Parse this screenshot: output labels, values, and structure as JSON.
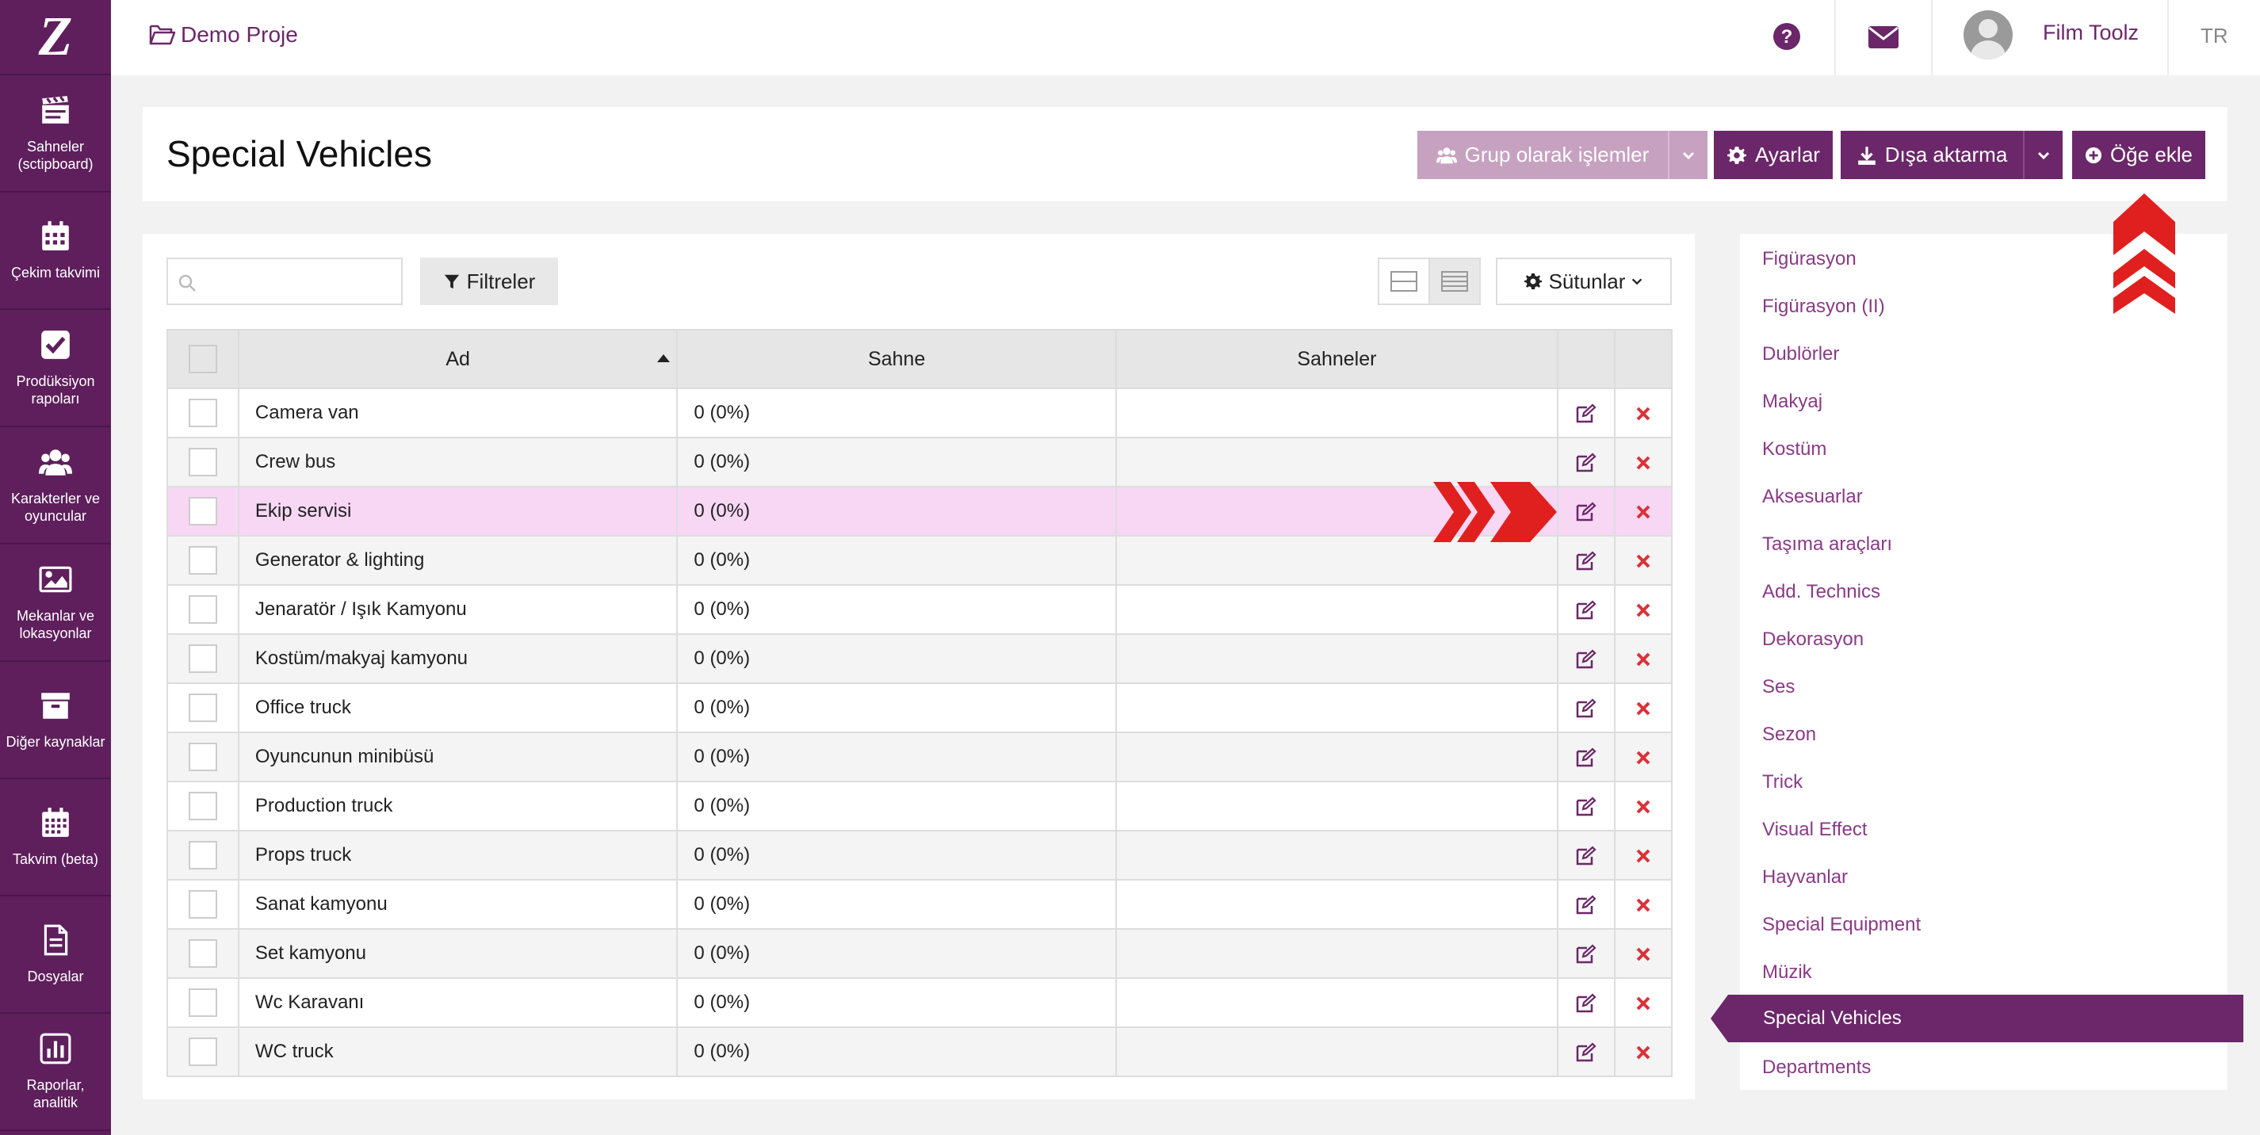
{
  "app": {
    "logo": "Z",
    "project_name": "Demo Proje",
    "user_name": "Film Toolz",
    "language": "TR"
  },
  "sidebar": {
    "items": [
      {
        "label": "Sahneler (sctipboard)",
        "icon": "clapperboard-icon"
      },
      {
        "label": "Çekim takvimi",
        "icon": "calendar-icon"
      },
      {
        "label": "Prodüksiyon rapoları",
        "icon": "checkbox-icon"
      },
      {
        "label": "Karakterler ve oyuncular",
        "icon": "users-icon"
      },
      {
        "label": "Mekanlar ve lokasyonlar",
        "icon": "image-icon"
      },
      {
        "label": "Diğer kaynaklar",
        "icon": "archive-icon"
      },
      {
        "label": "Takvim (beta)",
        "icon": "calendar-grid-icon"
      },
      {
        "label": "Dosyalar",
        "icon": "file-icon"
      },
      {
        "label": "Raporlar, analitik",
        "icon": "bar-chart-icon"
      }
    ]
  },
  "header": {
    "title": "Special Vehicles",
    "group_actions": "Grup olarak işlemler",
    "settings": "Ayarlar",
    "export": "Dışa aktarma",
    "add_item": "Öğe ekle"
  },
  "toolbar": {
    "search_placeholder": "",
    "filters": "Filtreler",
    "columns": "Sütunlar"
  },
  "table": {
    "headers": [
      "Ad",
      "Sahne",
      "Sahneler"
    ],
    "rows": [
      {
        "name": "Camera van",
        "scene": "0 (0%)",
        "scenes": ""
      },
      {
        "name": "Crew bus",
        "scene": "0 (0%)",
        "scenes": ""
      },
      {
        "name": "Ekip servisi",
        "scene": "0 (0%)",
        "scenes": ""
      },
      {
        "name": "Generator & lighting",
        "scene": "0 (0%)",
        "scenes": ""
      },
      {
        "name": "Jenaratör / Işık Kamyonu",
        "scene": "0 (0%)",
        "scenes": ""
      },
      {
        "name": "Kostüm/makyaj kamyonu",
        "scene": "0 (0%)",
        "scenes": ""
      },
      {
        "name": "Office truck",
        "scene": "0 (0%)",
        "scenes": ""
      },
      {
        "name": "Oyuncunun minibüsü",
        "scene": "0 (0%)",
        "scenes": ""
      },
      {
        "name": "Production truck",
        "scene": "0 (0%)",
        "scenes": ""
      },
      {
        "name": "Props truck",
        "scene": "0 (0%)",
        "scenes": ""
      },
      {
        "name": "Sanat kamyonu",
        "scene": "0 (0%)",
        "scenes": ""
      },
      {
        "name": "Set kamyonu",
        "scene": "0 (0%)",
        "scenes": ""
      },
      {
        "name": "Wc Karavanı",
        "scene": "0 (0%)",
        "scenes": ""
      },
      {
        "name": "WC truck",
        "scene": "0 (0%)",
        "scenes": ""
      }
    ],
    "highlighted_row": "Ekip servisi"
  },
  "categories": {
    "items": [
      "Figürasyon",
      "Figürasyon (II)",
      "Dublörler",
      "Makyaj",
      "Kostüm",
      "Aksesuarlar",
      "Taşıma araçları",
      "Add. Technics",
      "Dekorasyon",
      "Ses",
      "Sezon",
      "Trick",
      "Visual Effect",
      "Hayvanlar",
      "Special Equipment",
      "Müzik",
      "Special Vehicles",
      "Departments"
    ],
    "active": "Special Vehicles"
  },
  "colors": {
    "brand": "#6b2769",
    "brand_light": "#c6a1c0",
    "highlight_row": "#f8d7f5",
    "delete": "#d9333a",
    "annotation_arrow": "#e0201e"
  }
}
